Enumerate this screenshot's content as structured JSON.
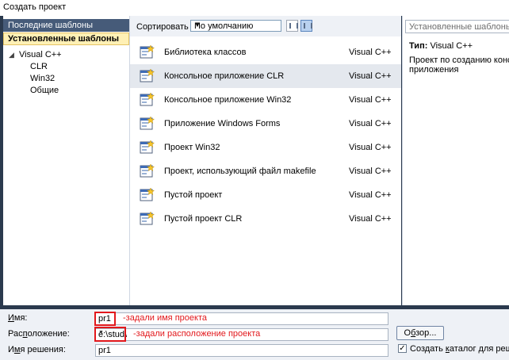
{
  "window": {
    "title": "Создать проект"
  },
  "left_pane": {
    "recent_templates": "Последние шаблоны",
    "installed_templates": "Установленные шаблоны",
    "tree": [
      {
        "label": "Visual C++",
        "expander": "◢",
        "level": 0
      },
      {
        "label": "CLR",
        "level": 1
      },
      {
        "label": "Win32",
        "level": 1
      },
      {
        "label": "Общие",
        "level": 1
      }
    ]
  },
  "center_pane": {
    "sort_label": "Сортировать по:",
    "sort_value": "По умолчанию",
    "templates": [
      {
        "name": "Библиотека классов",
        "lang": "Visual C++",
        "icon": "class-library-icon",
        "selected": false
      },
      {
        "name": "Консольное приложение CLR",
        "lang": "Visual C++",
        "icon": "clr-console-icon",
        "selected": true
      },
      {
        "name": "Консольное приложение Win32",
        "lang": "Visual C++",
        "icon": "win32-console-icon",
        "selected": false
      },
      {
        "name": "Приложение Windows Forms",
        "lang": "Visual C++",
        "icon": "windows-forms-icon",
        "selected": false
      },
      {
        "name": "Проект Win32",
        "lang": "Visual C++",
        "icon": "win32-project-icon",
        "selected": false
      },
      {
        "name": "Проект, использующий файл makefile",
        "lang": "Visual C++",
        "icon": "makefile-project-icon",
        "selected": false
      },
      {
        "name": "Пустой проект",
        "lang": "Visual C++",
        "icon": "empty-project-icon",
        "selected": false
      },
      {
        "name": "Пустой проект CLR",
        "lang": "Visual C++",
        "icon": "empty-clr-project-icon",
        "selected": false
      }
    ]
  },
  "right_pane": {
    "search_placeholder": "Установленные шаблоны: поиск",
    "type_label": "Тип:",
    "type_value": "Visual C++",
    "description_line1": "Проект по созданию консольного",
    "description_line2": "приложения"
  },
  "form": {
    "name_label_underlined": "И",
    "name_label_rest": "мя:",
    "name_value": "pr1",
    "name_note": "-задали имя проекта",
    "location_label_pre": "Рас",
    "location_label_underlined": "п",
    "location_label_rest": "оложение:",
    "location_value": "e:\\stud\\",
    "location_note": "-задали расположение проекта",
    "solution_label_pre": "И",
    "solution_label_underlined": "м",
    "solution_label_rest": "я решения:",
    "solution_value": "pr1",
    "browse_pre": "О",
    "browse_underlined": "б",
    "browse_rest": "зор...",
    "create_dir_checked": true,
    "create_dir_pre": "Создать ",
    "create_dir_underlined": "к",
    "create_dir_rest": "аталог для решения"
  },
  "colors": {
    "highlight_red": "#e2181c",
    "header_dark": "#465b79",
    "installed_bg": "#fff0b5",
    "selected_row": "#e4e8ee"
  }
}
